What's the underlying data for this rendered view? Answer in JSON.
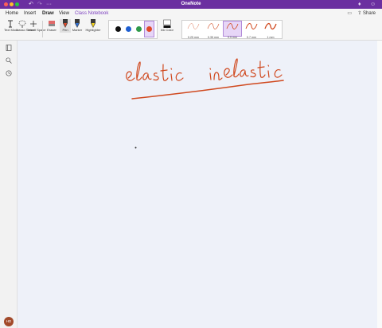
{
  "app": {
    "title": "OneNote"
  },
  "menu": {
    "tabs": [
      {
        "label": "Home"
      },
      {
        "label": "Insert"
      },
      {
        "label": "Draw"
      },
      {
        "label": "View"
      },
      {
        "label": "Class Notebook"
      }
    ],
    "active_tab": "Draw",
    "share_label": "Share"
  },
  "ribbon": {
    "tools": [
      {
        "label": "Text Mode"
      },
      {
        "label": "Lasso Select"
      },
      {
        "label": "Insert Space"
      },
      {
        "label": "Eraser"
      },
      {
        "label": "Pen"
      },
      {
        "label": "Marker"
      },
      {
        "label": "Highlighter"
      }
    ],
    "ink_colors": [
      "#111111",
      "#1f5fd1",
      "#2f9a4a",
      "#e0492a"
    ],
    "selected_color_index": 3,
    "ink_color_label": "Ink Color",
    "thicknesses": [
      {
        "label": "0.25 mm"
      },
      {
        "label": "0.35 mm"
      },
      {
        "label": "0.5 mm"
      },
      {
        "label": "0.7 mm"
      },
      {
        "label": "1 mm"
      }
    ],
    "selected_thickness_index": 2
  },
  "user": {
    "initials": "HD"
  },
  "canvas": {
    "handwriting": "elastic   in elastic",
    "ink_color": "#d0491f"
  },
  "colors": {
    "accent": "#7c3fbf",
    "titlebar": "#6b2fa0"
  }
}
